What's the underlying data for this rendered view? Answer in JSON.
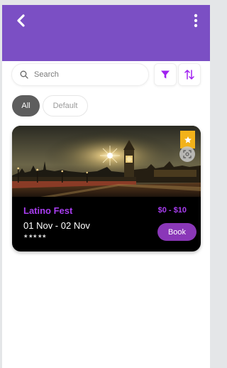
{
  "header": {
    "back_icon": "chevron-left-icon",
    "menu_icon": "more-vertical-icon",
    "bg_color": "#7b4fc4"
  },
  "search": {
    "placeholder": "Search",
    "value": "",
    "icon": "search-icon"
  },
  "toolbar": {
    "filter_icon": "filter-icon",
    "sort_icon": "sort-arrows-icon",
    "icon_color": "#a020f0"
  },
  "filters": {
    "chips": [
      {
        "label": "All",
        "selected": true
      },
      {
        "label": "Default",
        "selected": false
      }
    ]
  },
  "events": [
    {
      "title": "Latino Fest",
      "price": "$0 - $10",
      "dates": "01 Nov - 02 Nov",
      "rating": 5,
      "book_label": "Book",
      "favorite": true,
      "image": "city-night-clock-tower-photo"
    }
  ],
  "colors": {
    "accent": "#a83df0",
    "book_button": "#8a37b8",
    "favorite_badge": "#f2b21a"
  }
}
